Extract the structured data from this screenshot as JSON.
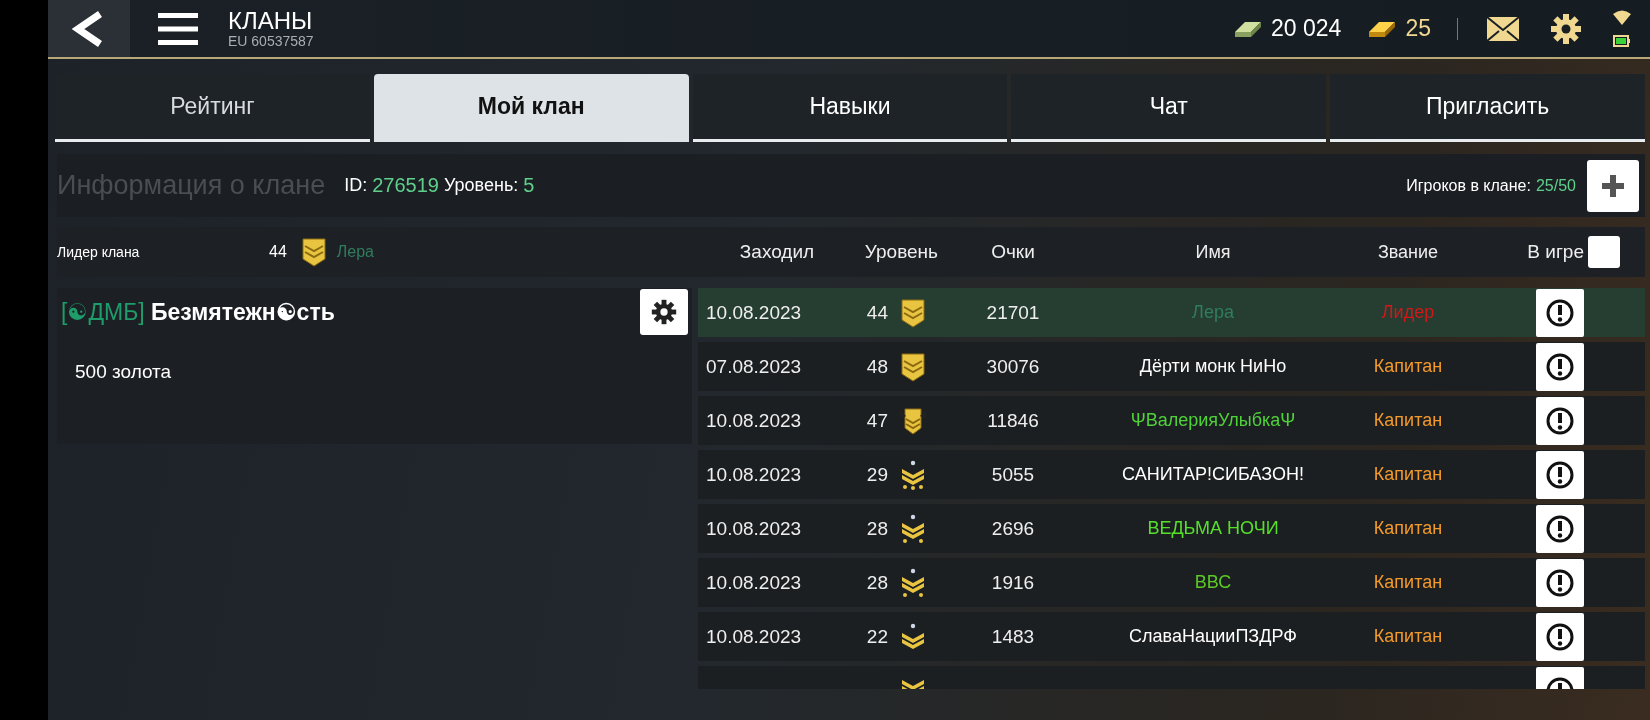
{
  "top_bar": {
    "title": "КЛАНЫ",
    "subtitle": "EU 60537587",
    "cash": "20 024",
    "gold": "25"
  },
  "tabs": [
    {
      "label": "Рейтинг",
      "selected": false
    },
    {
      "label": "Мой клан",
      "selected": true
    },
    {
      "label": "Навыки",
      "selected": false
    },
    {
      "label": "Чат",
      "selected": false
    },
    {
      "label": "Пригласить",
      "selected": false
    }
  ],
  "clan_info": {
    "heading": "Информация о клане",
    "id_label": "ID:",
    "id": "276519",
    "level_label": "Уровень:",
    "level": "5",
    "members_label": "Игроков в клане:",
    "members": "25/50"
  },
  "leader": {
    "label": "Лидер клана",
    "level": "44",
    "insignia": {
      "kind": "shield"
    },
    "name": "Лера"
  },
  "clan_card": {
    "tag": "[☯ДМБ]",
    "name": "Безмятежн☯сть",
    "note": "500 золота"
  },
  "table": {
    "columns": [
      "Заходил",
      "Уровень",
      "Очки",
      "Имя",
      "Звание",
      "В игре"
    ],
    "online_only": false,
    "rows": [
      {
        "kind": "full",
        "selected": true,
        "date": "10.08.2023",
        "level": "44",
        "insignia": {
          "kind": "shield"
        },
        "points": "21701",
        "name": {
          "text": "Лера",
          "color": "#2f7d5c"
        },
        "title": {
          "text": "Лидер",
          "color": "#d01818"
        }
      },
      {
        "kind": "full",
        "selected": false,
        "date": "07.08.2023",
        "level": "48",
        "insignia": {
          "kind": "shield"
        },
        "points": "30076",
        "name": {
          "text": "Дёрти монк НиНо",
          "color": "#ffffff"
        },
        "title": {
          "text": "Капитан",
          "color": "#f39a2a"
        }
      },
      {
        "kind": "full",
        "selected": false,
        "date": "10.08.2023",
        "level": "47",
        "insignia": {
          "kind": "winged"
        },
        "points": "11846",
        "name": {
          "text": "ΨВалерияУлыбкаΨ",
          "color": "#4fd13a"
        },
        "title": {
          "text": "Капитан",
          "color": "#f39a2a"
        }
      },
      {
        "kind": "full",
        "selected": false,
        "date": "10.08.2023",
        "level": "29",
        "insignia": {
          "kind": "stars3"
        },
        "points": "5055",
        "name": {
          "text": "САНИТАР!СИБАЗОН!",
          "color": "#ffffff"
        },
        "title": {
          "text": "Капитан",
          "color": "#f39a2a"
        }
      },
      {
        "kind": "full",
        "selected": false,
        "date": "10.08.2023",
        "level": "28",
        "insignia": {
          "kind": "stars2"
        },
        "points": "2696",
        "name": {
          "text": "ВЕДЬМА НОЧИ",
          "color": "#56e02b"
        },
        "title": {
          "text": "Капитан",
          "color": "#f39a2a"
        }
      },
      {
        "kind": "full",
        "selected": false,
        "date": "10.08.2023",
        "level": "28",
        "insignia": {
          "kind": "stars2"
        },
        "points": "1916",
        "name": {
          "text": "ВВС",
          "color": "#5cc925"
        },
        "title": {
          "text": "Капитан",
          "color": "#f39a2a"
        }
      },
      {
        "kind": "full",
        "selected": false,
        "date": "10.08.2023",
        "level": "22",
        "insignia": {
          "kind": "star1"
        },
        "points": "1483",
        "name": {
          "text": "СлаваНацииПЗДРФ",
          "color": "#ffffff"
        },
        "title": {
          "text": "Капитан",
          "color": "#f39a2a"
        }
      },
      {
        "kind": "clipped",
        "selected": false,
        "insignia": {
          "kind": "chevron"
        }
      }
    ]
  }
}
